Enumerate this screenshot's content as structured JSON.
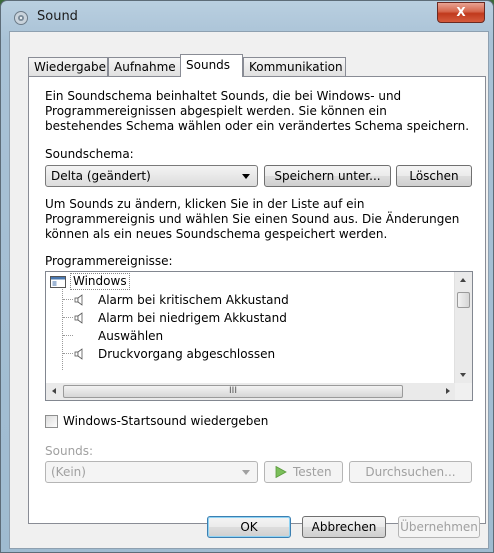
{
  "window": {
    "title": "Sound",
    "close_label": "X"
  },
  "tabs": [
    {
      "label": "Wiedergabe",
      "active": false
    },
    {
      "label": "Aufnahme",
      "active": false
    },
    {
      "label": "Sounds",
      "active": true
    },
    {
      "label": "Kommunikation",
      "active": false
    }
  ],
  "intro": [
    "Ein Soundschema beinhaltet Sounds, die bei Windows- und",
    "Programmereignissen abgespielt werden. Sie können ein",
    "bestehendes Schema wählen oder ein verändertes Schema speichern."
  ],
  "scheme": {
    "label": "Soundschema:",
    "value": "Delta (geändert)",
    "save_label": "Speichern unter...",
    "delete_label": "Löschen"
  },
  "instructions": [
    "Um Sounds zu ändern, klicken Sie in der Liste auf ein",
    "Programmereignis und wählen Sie einen Sound aus. Die Änderungen",
    "können als ein neues Soundschema gespeichert werden."
  ],
  "events": {
    "label": "Programmereignisse:",
    "group": "Windows",
    "items": [
      {
        "label": "Alarm bei kritischem Akkustand",
        "has_sound": true
      },
      {
        "label": "Alarm bei niedrigem Akkustand",
        "has_sound": true
      },
      {
        "label": "Auswählen",
        "has_sound": false
      },
      {
        "label": "Druckvorgang abgeschlossen",
        "has_sound": true
      }
    ],
    "hscroll_grip": "III"
  },
  "startup": {
    "label": "Windows-Startsound wiedergeben",
    "checked": false
  },
  "sounds": {
    "label": "Sounds:",
    "value": "(Kein)",
    "test_label": "Testen",
    "browse_label": "Durchsuchen..."
  },
  "footer": {
    "ok_label": "OK",
    "cancel_label": "Abbrechen",
    "apply_label": "Übernehmen"
  },
  "colors": {
    "accent": "#3c7fb1",
    "close_red": "#c0391c",
    "play_green": "#4caf2a"
  }
}
